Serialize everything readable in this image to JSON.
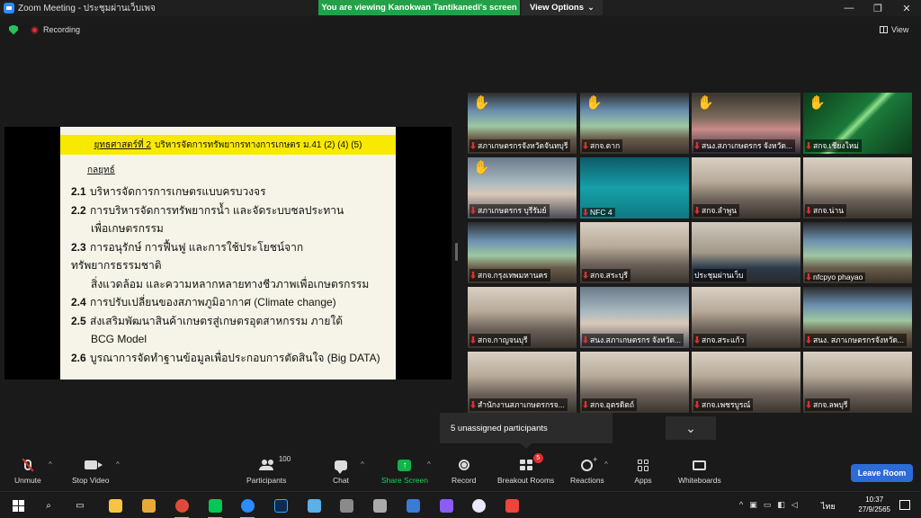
{
  "window": {
    "title": "Zoom Meeting - ประชุมผ่านเว็บเพจ",
    "banner": "You are viewing Kanokwan Tantikanedi's screen",
    "view_options": "View Options",
    "controls": [
      "—",
      "❐",
      "✕"
    ]
  },
  "status": {
    "recording": "Recording",
    "view": "View"
  },
  "slide": {
    "title_prefix": "ยุทธศาสตร์ที่ 2",
    "title_rest": "บริหารจัดการทรัพยากรทางการเกษตร ม.41 (2) (4) (5)",
    "subtitle": "กลยุทธ์",
    "items": [
      {
        "num": "2.1",
        "text": "บริหารจัดการการเกษตรแบบครบวงจร",
        "cont": ""
      },
      {
        "num": "2.2",
        "text": "การบริหารจัดการทรัพยากรน้ำ และจัดระบบชลประทาน",
        "cont": "เพื่อเกษตรกรรม"
      },
      {
        "num": "2.3",
        "text": "การอนุรักษ์ การฟื้นฟู และการใช้ประโยชน์จากทรัพยากรธรรมชาติ",
        "cont": "สิ่งแวดล้อม และความหลากหลายทางชีวภาพเพื่อเกษตรกรรม"
      },
      {
        "num": "2.4",
        "text": "การปรับเปลี่ยนของสภาพภูมิอากาศ (Climate change)",
        "cont": ""
      },
      {
        "num": "2.5",
        "text": "ส่งเสริมพัฒนาสินค้าเกษตรสู่เกษตรอุตสาหกรรม ภายใต้",
        "cont": "BCG Model"
      },
      {
        "num": "2.6",
        "text": "บูรณาการจัดทำฐานข้อมูลเพื่อประกอบการตัดสินใจ (Big DATA)",
        "cont": ""
      }
    ]
  },
  "gallery": {
    "tiles": [
      {
        "label": "สภาเกษตรกรจังหวัดจันทบุรี",
        "muted": true,
        "hand": true,
        "active": false,
        "scene": "banner"
      },
      {
        "label": "สกจ.ตาก",
        "muted": true,
        "hand": true,
        "active": true,
        "scene": "banner"
      },
      {
        "label": "สนง.สภาเกษตรกร จังหวัด...",
        "muted": true,
        "hand": true,
        "active": false,
        "scene": "people"
      },
      {
        "label": "สกจ.เชียงใหม่",
        "muted": true,
        "hand": true,
        "active": false,
        "scene": "green"
      },
      {
        "label": "สภาเกษตรกร บุรีรัมย์",
        "muted": true,
        "hand": true,
        "active": false,
        "scene": "person"
      },
      {
        "label": "NFC 4",
        "muted": true,
        "hand": false,
        "active": false,
        "scene": "teal"
      },
      {
        "label": "สกจ.ลำพูน",
        "muted": true,
        "hand": false,
        "active": false,
        "scene": "room"
      },
      {
        "label": "สกจ.น่าน",
        "muted": true,
        "hand": false,
        "active": false,
        "scene": "room"
      },
      {
        "label": "สกจ.กรุงเทพมหานคร",
        "muted": true,
        "hand": false,
        "active": false,
        "scene": "banner"
      },
      {
        "label": "สกจ.สระบุรี",
        "muted": true,
        "hand": false,
        "active": false,
        "scene": "room"
      },
      {
        "label": "ประชุมผ่านเว็บ",
        "muted": false,
        "hand": false,
        "active": false,
        "scene": "office"
      },
      {
        "label": "nfcpyo phayao",
        "muted": true,
        "hand": false,
        "active": false,
        "scene": "banner"
      },
      {
        "label": "สกจ.กาญจนบุรี",
        "muted": true,
        "hand": false,
        "active": false,
        "scene": "room"
      },
      {
        "label": "สนง.สภาเกษตรกร จังหวัด...",
        "muted": true,
        "hand": false,
        "active": false,
        "scene": "person"
      },
      {
        "label": "สกจ.สระแก้ว",
        "muted": true,
        "hand": false,
        "active": false,
        "scene": "room"
      },
      {
        "label": "สนง. สภาเกษตรกรจังหวัด...",
        "muted": true,
        "hand": false,
        "active": false,
        "scene": "banner"
      },
      {
        "label": "สำนักงานสภาเกษตรกรจ...",
        "muted": true,
        "hand": false,
        "active": false,
        "scene": "room"
      },
      {
        "label": "สกจ.อุตรดิตถ์",
        "muted": true,
        "hand": false,
        "active": false,
        "scene": "room"
      },
      {
        "label": "สกจ.เพชรบูรณ์",
        "muted": true,
        "hand": false,
        "active": false,
        "scene": "room"
      },
      {
        "label": "สกจ.ลพบุรี",
        "muted": true,
        "hand": false,
        "active": false,
        "scene": "room"
      }
    ],
    "unassigned": "5 unassigned participants"
  },
  "toolbar": {
    "unmute": "Unmute",
    "stop_video": "Stop Video",
    "participants": "Participants",
    "participants_count": "100",
    "chat": "Chat",
    "share_screen": "Share Screen",
    "record": "Record",
    "breakout_rooms": "Breakout Rooms",
    "breakout_badge": "5",
    "reactions": "Reactions",
    "apps": "Apps",
    "whiteboards": "Whiteboards",
    "leave": "Leave Room"
  },
  "taskbar": {
    "time": "10:37",
    "date": "27/9/2565",
    "lang": "ไทย",
    "apps": [
      "windows-start",
      "search",
      "task-view",
      "file-explorer",
      "files",
      "chrome",
      "line",
      "zoom",
      "photoshop",
      "app",
      "app",
      "app",
      "app",
      "visual-studio",
      "itunes",
      "anydesk"
    ]
  },
  "colors": {
    "banner_green": "#24a148",
    "slide_title_yellow": "#f7ea00",
    "active_tile_outline": "#d4d82a",
    "leave_blue": "#2d6bd6",
    "muted_red": "#e02f2f"
  }
}
